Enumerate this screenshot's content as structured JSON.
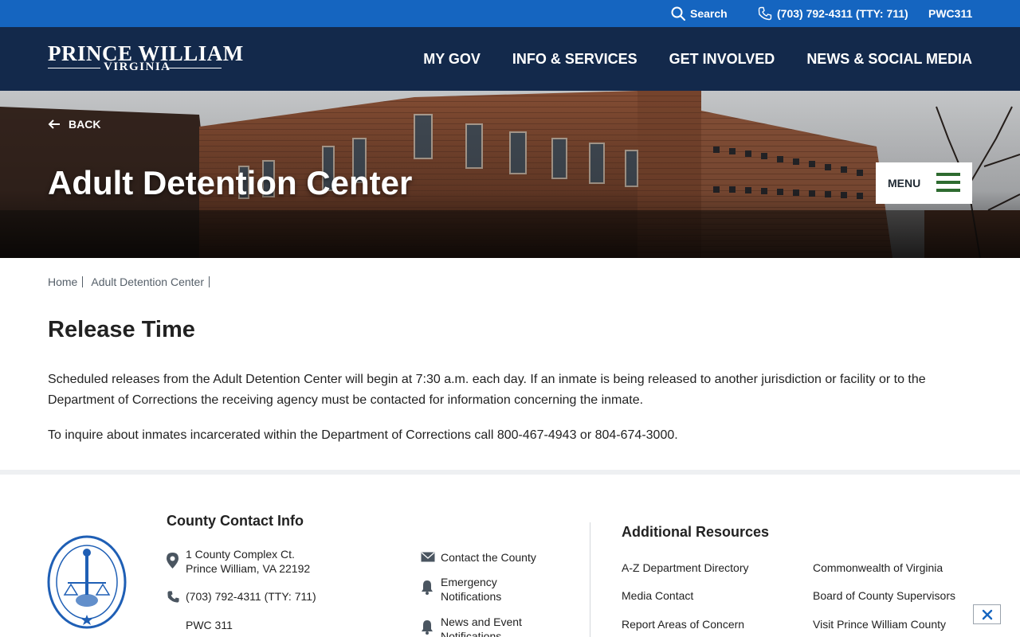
{
  "utility": {
    "search_label": "Search",
    "phone_label": "(703) 792-4311 (TTY: 711)",
    "pwc311_label": "PWC311"
  },
  "header": {
    "logo_top": "PRINCE WILLIAM",
    "logo_bottom": "VIRGINIA",
    "nav": [
      "MY GOV",
      "INFO & SERVICES",
      "GET INVOLVED",
      "NEWS & SOCIAL MEDIA"
    ]
  },
  "hero": {
    "back_label": "BACK",
    "title": "Adult Detention Center",
    "menu_label": "MENU"
  },
  "breadcrumb": [
    "Home",
    "Adult Detention Center"
  ],
  "content": {
    "title": "Release Time",
    "p1": "Scheduled releases from the Adult Detention Center will begin at 7:30 a.m. each day. If an inmate is being released to another jurisdiction or facility or to the Department of Corrections the receiving agency must be contacted for information concerning the inmate.",
    "p2": "To inquire about inmates incarcerated within the Department of Corrections call 800-467-4943 or 804-674-3000."
  },
  "footer": {
    "contact_heading": "County Contact Info",
    "address_line1": "1 County Complex Ct.",
    "address_line2": "Prince William, VA 22192",
    "phone": "(703) 792-4311 (TTY: 711)",
    "pwc311": "PWC 311",
    "contact_county": "Contact the County",
    "emergency_line1": "Emergency",
    "emergency_line2": "Notifications",
    "news_line1": "News and Event",
    "news_line2": "Notifications",
    "resources_heading": "Additional Resources",
    "resources": [
      "A-Z Department Directory",
      "Commonwealth of Virginia",
      "Media Contact",
      "Board of County Supervisors",
      "Report Areas of Concern",
      "Visit Prince William County"
    ],
    "seal_text": "THE SEAL OF PRINCE WILLIAM COUNTY VA"
  },
  "colors": {
    "utility_bar": "#1565c0",
    "header_bg": "#13294b",
    "menu_icon": "#2e6b30",
    "seal": "#1f5fb5"
  }
}
